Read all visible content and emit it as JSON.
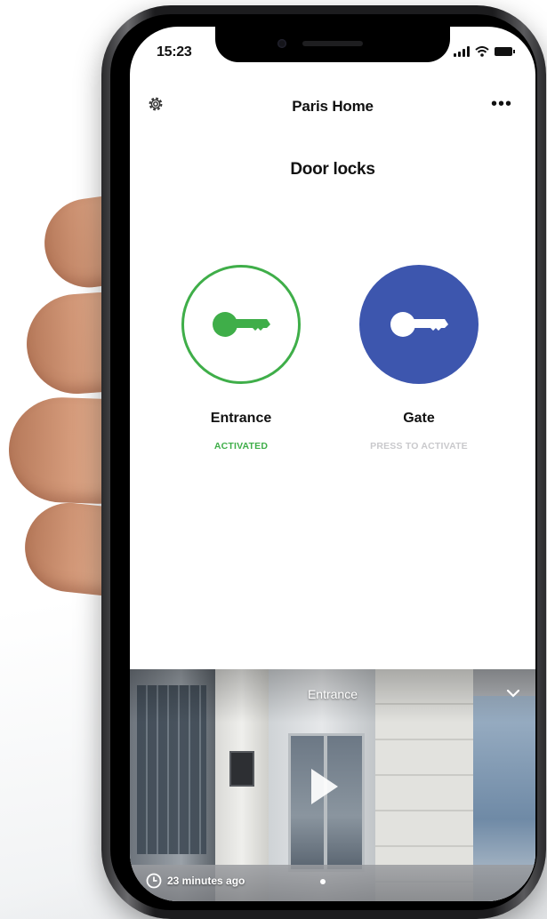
{
  "status_bar": {
    "time": "15:23",
    "icons": [
      "signal-icon",
      "wifi-icon",
      "battery-icon"
    ]
  },
  "header": {
    "settings_icon": "gear-icon",
    "title": "Paris Home",
    "more_label": "•••"
  },
  "section": {
    "title": "Door locks"
  },
  "locks": [
    {
      "name": "Entrance",
      "status": "ACTIVATED",
      "color": "#3fae49",
      "icon": "key-icon"
    },
    {
      "name": "Gate",
      "status": "PRESS TO ACTIVATE",
      "color": "#3d56ae",
      "icon": "key-icon"
    }
  ],
  "camera": {
    "label": "Entrance",
    "time_ago": "23 minutes ago",
    "icons": [
      "chevron-down-icon",
      "play-icon",
      "clock-icon"
    ]
  }
}
